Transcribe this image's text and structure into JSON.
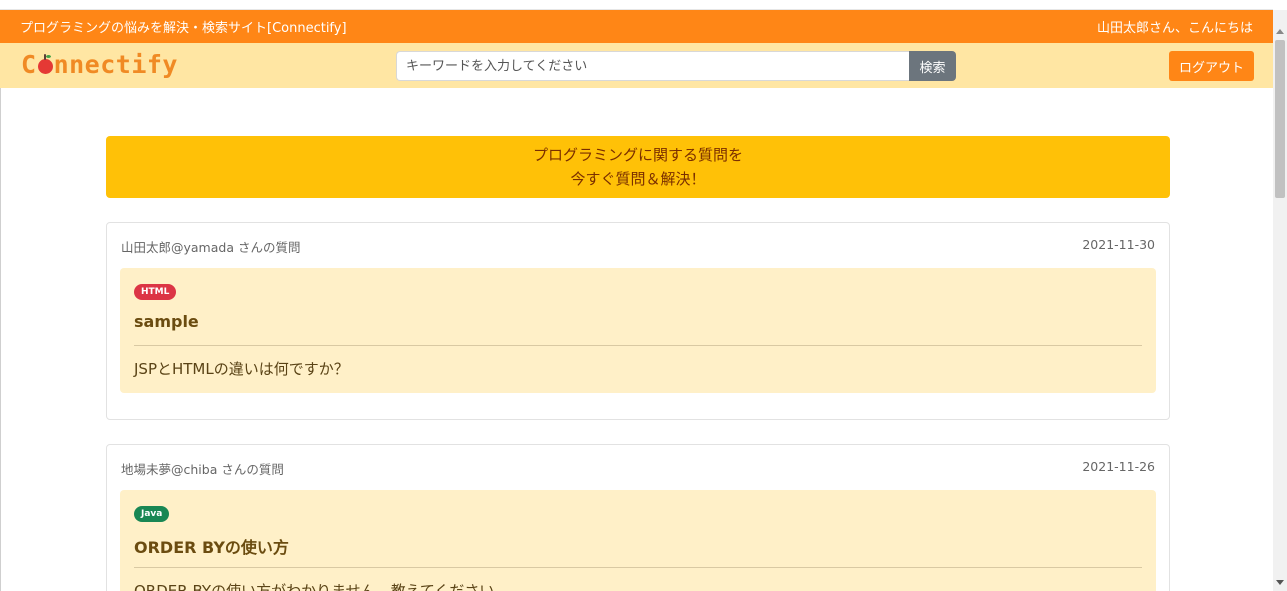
{
  "topbar": {
    "site_title": "プログラミングの悩みを解決・検索サイト[Connectify]",
    "greeting": "山田太郎さん、こんにちは"
  },
  "header": {
    "logo_before": "C",
    "logo_after": "nnectify",
    "search_placeholder": "キーワードを入力してください",
    "search_button": "検索",
    "logout_button": "ログアウト"
  },
  "banner": {
    "line1": "プログラミングに関する質問を",
    "line2": "今すぐ質問＆解決！"
  },
  "questions": [
    {
      "author": "山田太郎@yamada さんの質問",
      "date": "2021-11-30",
      "tag": "HTML",
      "tag_color": "#dc3545",
      "title": "sample",
      "body": "JSPとHTMLの違いは何ですか？"
    },
    {
      "author": "地場未夢@chiba さんの質問",
      "date": "2021-11-26",
      "tag": "Java",
      "tag_color": "#198754",
      "title": "ORDER BYの使い方",
      "body": "ORDER BYの使い方がわかりません。教えてください。"
    }
  ],
  "colors": {
    "accent": "#ff8616",
    "header_bg": "#ffe6a3",
    "banner_bg": "#ffc107",
    "card_body_bg": "#fff0c8"
  }
}
